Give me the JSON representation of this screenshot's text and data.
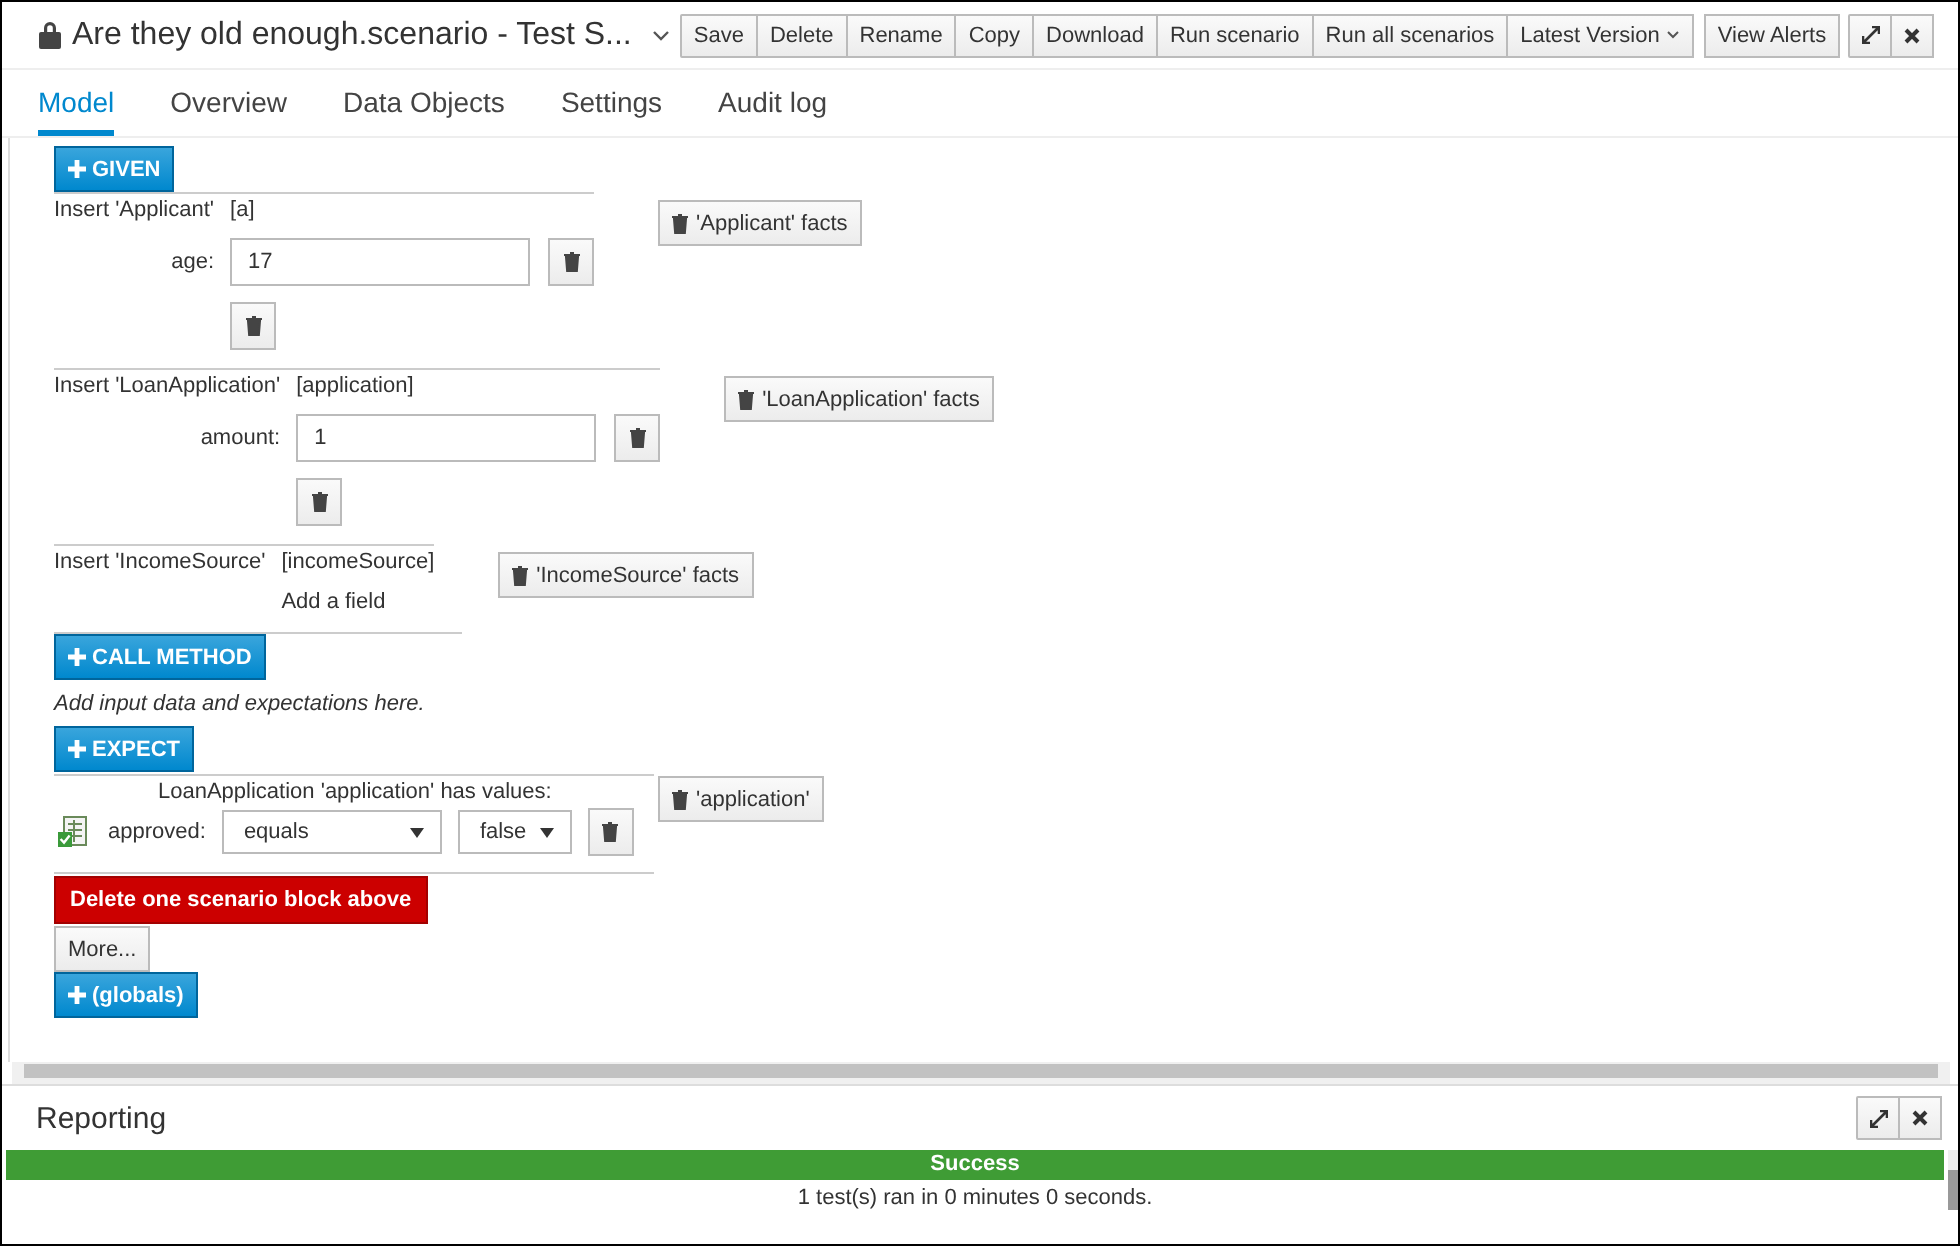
{
  "header": {
    "title": "Are they old enough.scenario - Test S...",
    "buttons": [
      "Save",
      "Delete",
      "Rename",
      "Copy",
      "Download",
      "Run scenario",
      "Run all scenarios"
    ],
    "version_menu": "Latest Version",
    "alerts_button": "View Alerts"
  },
  "tabs": [
    {
      "label": "Model",
      "selected": true
    },
    {
      "label": "Overview",
      "selected": false
    },
    {
      "label": "Data Objects",
      "selected": false
    },
    {
      "label": "Settings",
      "selected": false
    },
    {
      "label": "Audit log",
      "selected": false
    }
  ],
  "given_button": "GIVEN",
  "facts": [
    {
      "insert": "Insert 'Applicant'",
      "variable": "[a]",
      "fields": [
        {
          "label": "age:",
          "value": "17"
        }
      ],
      "delete_button": "'Applicant' facts"
    },
    {
      "insert": "Insert 'LoanApplication'",
      "variable": "[application]",
      "fields": [
        {
          "label": "amount:",
          "value": "1"
        }
      ],
      "delete_button": "'LoanApplication' facts"
    },
    {
      "insert": "Insert 'IncomeSource'",
      "variable": "[incomeSource]",
      "add_field": "Add a field",
      "delete_button": "'IncomeSource' facts"
    }
  ],
  "call_method_button": "CALL METHOD",
  "hint": "Add input data and expectations here.",
  "expect_button": "EXPECT",
  "expectation": {
    "heading": "LoanApplication 'application' has values:",
    "field": "approved:",
    "operator": "equals",
    "value": "false",
    "delete_button": "'application'"
  },
  "delete_block_button": "Delete one scenario block above",
  "more_button": "More...",
  "globals_button": "(globals)",
  "reporting": {
    "title": "Reporting",
    "kind": "success",
    "status": "Success",
    "message": "1 test(s) ran in 0 minutes 0 seconds."
  }
}
